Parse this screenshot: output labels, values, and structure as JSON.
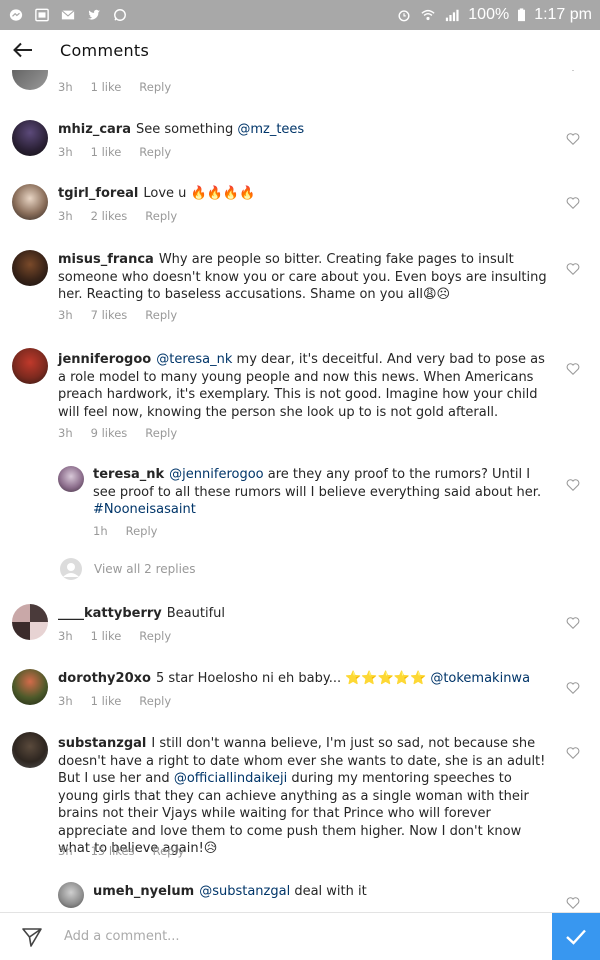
{
  "status_bar": {
    "battery": "100%",
    "time": "1:17 pm"
  },
  "header": {
    "title": "Comments"
  },
  "comments": [
    {
      "username": "",
      "text": "",
      "time": "3h",
      "likes": "1 like",
      "reply": "Reply"
    },
    {
      "username": "mhiz_cara",
      "text": "See something ",
      "mention": "@mz_tees",
      "time": "3h",
      "likes": "1 like",
      "reply": "Reply"
    },
    {
      "username": "tgirl_foreal",
      "text": "Love u 🔥🔥🔥🔥",
      "time": "3h",
      "likes": "2 likes",
      "reply": "Reply"
    },
    {
      "username": "misus_franca",
      "text": "Why are people so bitter. Creating fake pages to insult someone who doesn't know you or care about you. Even boys are insulting her. Reacting to baseless accusations. Shame on you all😩☹",
      "time": "3h",
      "likes": "7 likes",
      "reply": "Reply"
    },
    {
      "username": "jenniferogoo",
      "mention": "@teresa_nk",
      "text": " my dear, it's deceitful. And very bad to pose as a role model to many young people and now this news. When Americans preach hardwork, it's exemplary. This is not good. Imagine how your child will feel now, knowing the person she look up to is not gold afterall.",
      "time": "3h",
      "likes": "9 likes",
      "reply": "Reply"
    },
    {
      "username": "teresa_nk",
      "mention": "@jenniferogoo",
      "text": " are they any proof to the rumors?  Until I see proof to all these rumors will I believe everything said about her. ",
      "hashtag": "#Nooneisasaint",
      "time": "1h",
      "reply": "Reply"
    },
    {
      "username": "____kattyberry",
      "text": "Beautiful",
      "time": "3h",
      "likes": "1 like",
      "reply": "Reply"
    },
    {
      "username": "dorothy20xo",
      "text": "5 star Hoelosho ni eh baby... ⭐⭐⭐⭐⭐ ",
      "mention": "@tokemakinwa",
      "time": "3h",
      "likes": "1 like",
      "reply": "Reply"
    },
    {
      "username": "substanzgal",
      "text_a": "I still don't wanna believe, I'm just so sad, not because she doesn't have a right to date whom ever she wants to date, she is an adult! But I use her and ",
      "mention": "@officiallindaikeji",
      "text_b": " during my mentoring speeches to young girls that they can achieve anything as a single woman with their brains not their Vjays while waiting for that Prince who will forever appreciate and love them to come push them higher. Now I don't know what to believe again!😥",
      "time": "3h",
      "likes": "15 likes",
      "reply": "Reply"
    },
    {
      "username": "umeh_nyelum",
      "mention": "@substanzgal",
      "text": " deal with it"
    }
  ],
  "view_replies": "View all 2 replies",
  "composer": {
    "placeholder": "Add a comment..."
  }
}
